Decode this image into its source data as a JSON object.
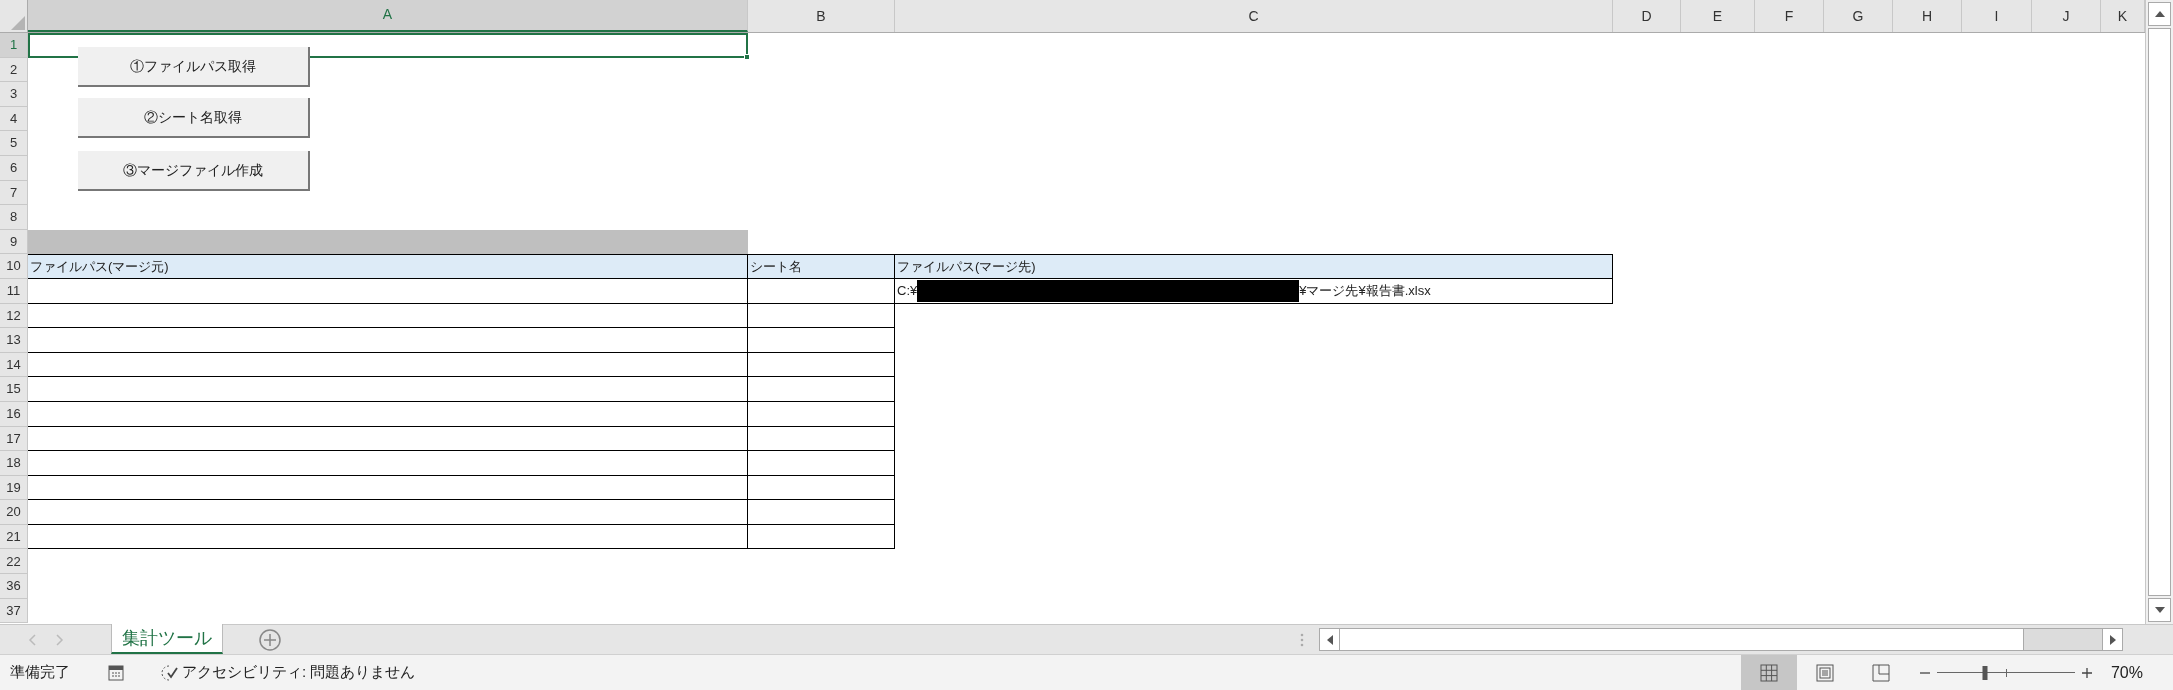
{
  "column_headers": [
    {
      "label": "A",
      "selected": true
    },
    {
      "label": "B",
      "selected": false
    },
    {
      "label": "C",
      "selected": false
    },
    {
      "label": "D",
      "selected": false
    },
    {
      "label": "E",
      "selected": false
    },
    {
      "label": "F",
      "selected": false
    },
    {
      "label": "G",
      "selected": false
    },
    {
      "label": "H",
      "selected": false
    },
    {
      "label": "I",
      "selected": false
    },
    {
      "label": "J",
      "selected": false
    },
    {
      "label": "K",
      "selected": false
    }
  ],
  "row_headers": [
    {
      "label": "1",
      "selected": true
    },
    {
      "label": "2",
      "selected": false
    },
    {
      "label": "3",
      "selected": false
    },
    {
      "label": "4",
      "selected": false
    },
    {
      "label": "5",
      "selected": false
    },
    {
      "label": "6",
      "selected": false
    },
    {
      "label": "7",
      "selected": false
    },
    {
      "label": "8",
      "selected": false
    },
    {
      "label": "9",
      "selected": false
    },
    {
      "label": "10",
      "selected": false
    },
    {
      "label": "11",
      "selected": false
    },
    {
      "label": "12",
      "selected": false
    },
    {
      "label": "13",
      "selected": false
    },
    {
      "label": "14",
      "selected": false
    },
    {
      "label": "15",
      "selected": false
    },
    {
      "label": "16",
      "selected": false
    },
    {
      "label": "17",
      "selected": false
    },
    {
      "label": "18",
      "selected": false
    },
    {
      "label": "19",
      "selected": false
    },
    {
      "label": "20",
      "selected": false
    },
    {
      "label": "21",
      "selected": false
    },
    {
      "label": "22",
      "selected": false
    },
    {
      "label": "36",
      "selected": false
    },
    {
      "label": "37",
      "selected": false
    }
  ],
  "macro_buttons": [
    "①ファイルパス取得",
    "②シート名取得",
    "③マージファイル作成"
  ],
  "table": {
    "headers": [
      "ファイルパス(マージ元)",
      "シート名",
      "ファイルパス(マージ先)"
    ],
    "destination": {
      "prefix": "C:¥",
      "redacted": true,
      "suffix": "¥マージ先¥報告書.xlsx"
    }
  },
  "sheet_tabs": [
    {
      "label": "集計ツール",
      "selected": true
    }
  ],
  "status_bar": {
    "status": "準備完了",
    "accessibility": "アクセシビリティ: 問題ありません",
    "views": [
      {
        "kind": "normal",
        "selected": true
      },
      {
        "kind": "page_layout",
        "selected": false
      },
      {
        "kind": "page_break",
        "selected": false
      }
    ],
    "zoom": {
      "level": 0.35,
      "label": "70%"
    }
  }
}
